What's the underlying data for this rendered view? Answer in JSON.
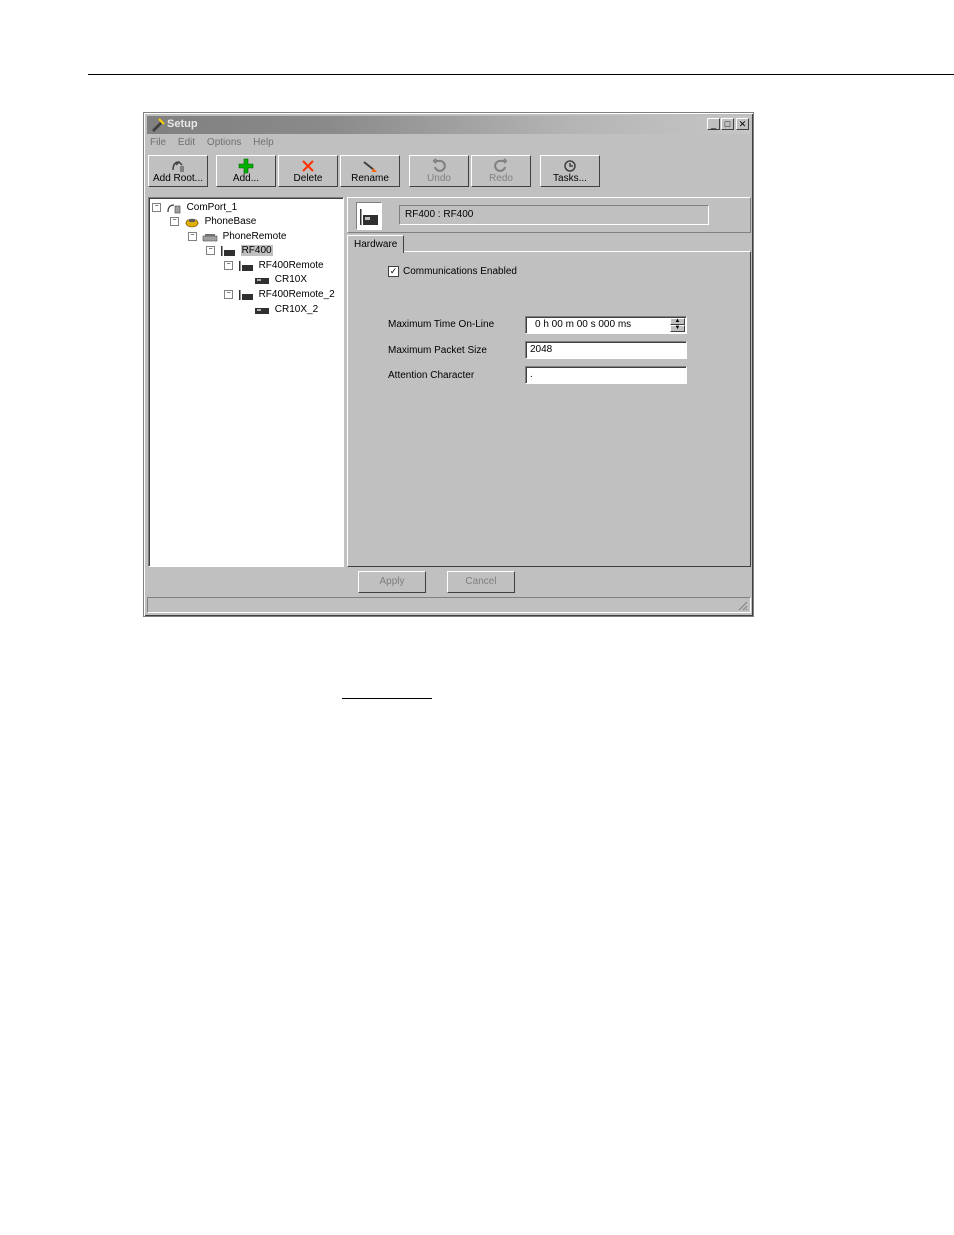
{
  "window": {
    "title": "Setup"
  },
  "menu": [
    "File",
    "Edit",
    "Options",
    "Help"
  ],
  "toolbar": {
    "buttons": [
      {
        "label": "Add Root...",
        "icon": "add-root-icon",
        "enabled": true
      },
      {
        "label": "Add...",
        "icon": "plus-icon",
        "enabled": true
      },
      {
        "label": "Delete",
        "icon": "delete-x-icon",
        "enabled": true
      },
      {
        "label": "Rename",
        "icon": "rename-icon",
        "enabled": true
      },
      {
        "label": "Undo",
        "icon": "undo-icon",
        "enabled": false
      },
      {
        "label": "Redo",
        "icon": "redo-icon",
        "enabled": false
      },
      {
        "label": "Tasks...",
        "icon": "tasks-icon",
        "enabled": true
      }
    ]
  },
  "tree": {
    "nodes": [
      {
        "label": "ComPort_1",
        "icon": "comport-icon",
        "expanded": true
      },
      {
        "label": "PhoneBase",
        "icon": "phonebase-icon",
        "expanded": true
      },
      {
        "label": "PhoneRemote",
        "icon": "phone-icon",
        "expanded": true
      },
      {
        "label": "RF400",
        "icon": "rf400-icon",
        "expanded": true,
        "selected": true
      },
      {
        "label": "RF400Remote",
        "icon": "rf400-icon",
        "expanded": true
      },
      {
        "label": "CR10X",
        "icon": "datalogger-icon"
      },
      {
        "label": "RF400Remote_2",
        "icon": "rf400-icon",
        "expanded": true
      },
      {
        "label": "CR10X_2",
        "icon": "datalogger-icon"
      }
    ]
  },
  "device": {
    "name": "RF400 : RF400",
    "icon": "rf400-device-icon"
  },
  "tabs": [
    "Hardware"
  ],
  "hardware": {
    "communications_enabled_label": "Communications Enabled",
    "communications_enabled": true,
    "max_time_label": "Maximum Time On-Line",
    "max_time_value": "0 h 00 m 00 s 000 ms",
    "max_packet_label": "Maximum Packet Size",
    "max_packet_value": "2048",
    "attention_label": "Attention Character",
    "attention_value": "."
  },
  "footer": {
    "apply": "Apply",
    "cancel": "Cancel"
  },
  "colors": {
    "window_bg": "#c0c0c0",
    "title_gradient_start": "#808080",
    "title_gradient_end": "#c6c6c6"
  }
}
